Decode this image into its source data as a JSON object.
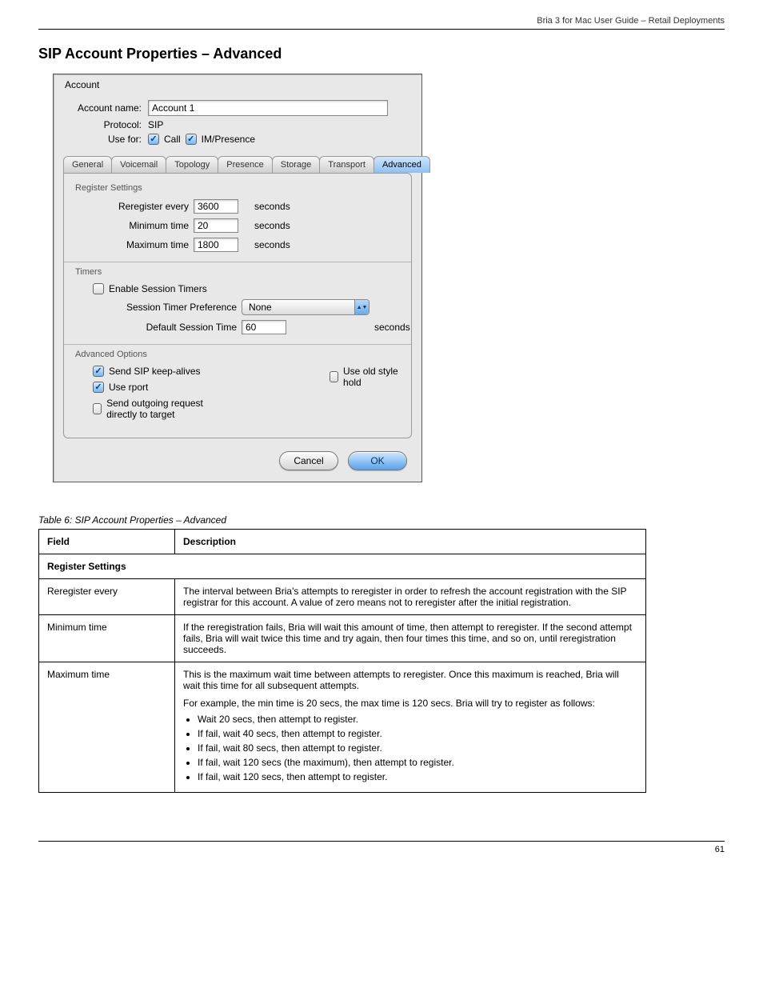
{
  "header_text": "Bria 3 for Mac User Guide – Retail Deployments",
  "section_title": "SIP Account Properties – Advanced",
  "dialog": {
    "title": "Account",
    "account_name_label": "Account name:",
    "account_name_value": "Account 1",
    "protocol_label": "Protocol:",
    "protocol_value": "SIP",
    "use_for_label": "Use for:",
    "use_for_call": "Call",
    "use_for_im": "IM/Presence",
    "tabs": [
      "General",
      "Voicemail",
      "Topology",
      "Presence",
      "Storage",
      "Transport",
      "Advanced"
    ],
    "register_settings": {
      "heading": "Register Settings",
      "reregister_label": "Reregister every",
      "reregister_value": "3600",
      "minimum_label": "Minimum time",
      "minimum_value": "20",
      "maximum_label": "Maximum time",
      "maximum_value": "1800",
      "seconds": "seconds"
    },
    "timers": {
      "heading": "Timers",
      "enable_label": "Enable Session Timers",
      "pref_label": "Session Timer Preference",
      "pref_value": "None",
      "default_label": "Default Session Time",
      "default_value": "60",
      "seconds": "seconds"
    },
    "advanced": {
      "heading": "Advanced Options",
      "keepalive": "Send SIP keep-alives",
      "oldhold": "Use old style hold",
      "rport": "Use rport",
      "direct": "Send outgoing request directly to target"
    },
    "buttons": {
      "cancel": "Cancel",
      "ok": "OK"
    }
  },
  "table": {
    "caption": "Table 6: SIP Account Properties – Advanced",
    "col_field": "Field",
    "col_desc": "Description",
    "rows": [
      {
        "kind": "section",
        "text": "Register Settings"
      },
      {
        "kind": "row",
        "field": "Reregister every",
        "desc": "The interval between Bria's attempts to reregister in order to refresh the account registration with the SIP registrar for this account. A value of zero means not to reregister after the initial registration."
      },
      {
        "kind": "row",
        "field": "Minimum time",
        "desc": "If the reregistration fails, Bria will wait this amount of time, then attempt to reregister. If the second attempt fails, Bria will wait twice this time and try again, then four times this time, and so on, until reregistration succeeds."
      },
      {
        "kind": "row",
        "field": "Maximum time",
        "desc_intro": "This is the maximum wait time between attempts to reregister. Once this maximum is reached, Bria will wait this time for all subsequent attempts.",
        "desc_example_lead": "For example, the min time is 20 secs, the max time is 120 secs. Bria will try to register as follows:",
        "bullets": [
          "Wait 20 secs, then attempt to register.",
          "If fail, wait 40 secs, then attempt to register.",
          "If fail, wait 80 secs, then attempt to register.",
          "If fail, wait 120 secs (the maximum), then attempt to register.",
          "If fail, wait 120 secs, then attempt to register."
        ]
      }
    ]
  },
  "footer": "61"
}
